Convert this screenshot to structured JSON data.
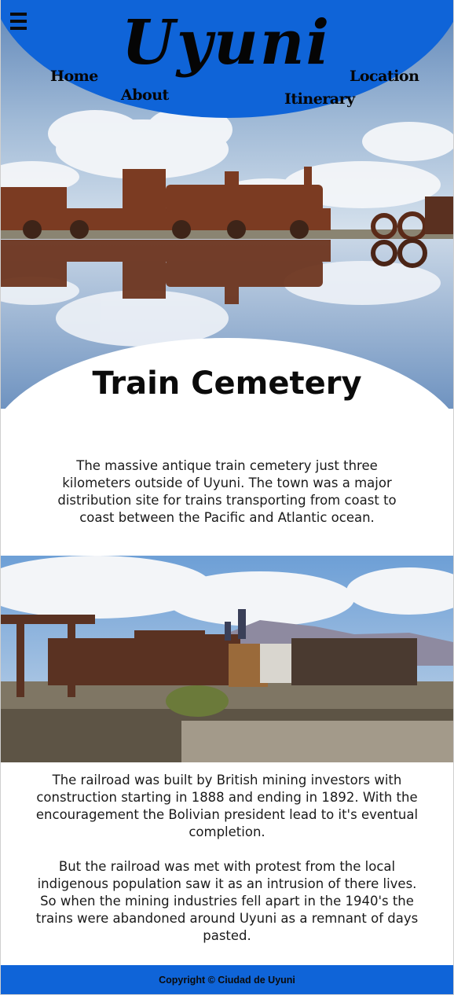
{
  "header": {
    "logo_text": "Uyuni",
    "nav": {
      "home": "Home",
      "about": "About",
      "itinerary": "Itinerary",
      "location": "Location"
    }
  },
  "section": {
    "title": "Train Cemetery",
    "intro": "The massive antique train cemetery just three kilometers outside of Uyuni. The town was a major distribution site for trains transporting from coast to coast between the Pacific and Atlantic ocean.",
    "history_1": "The railroad was built by British mining investors with construction starting in 1888 and ending in 1892. With the encouragement the Bolivian president lead to it's eventual completion.",
    "history_2": "But the railroad was met with protest from the local indigenous population saw it as an intrusion of there lives. So when the mining industries fell apart in the 1940's the trains were abandoned around Uyuni as a remnant of days pasted."
  },
  "footer": {
    "copyright": "Copyright © Ciudad de Uyuni"
  },
  "colors": {
    "brand_blue": "#0f64d8",
    "text_dark": "#0b0b0b"
  }
}
